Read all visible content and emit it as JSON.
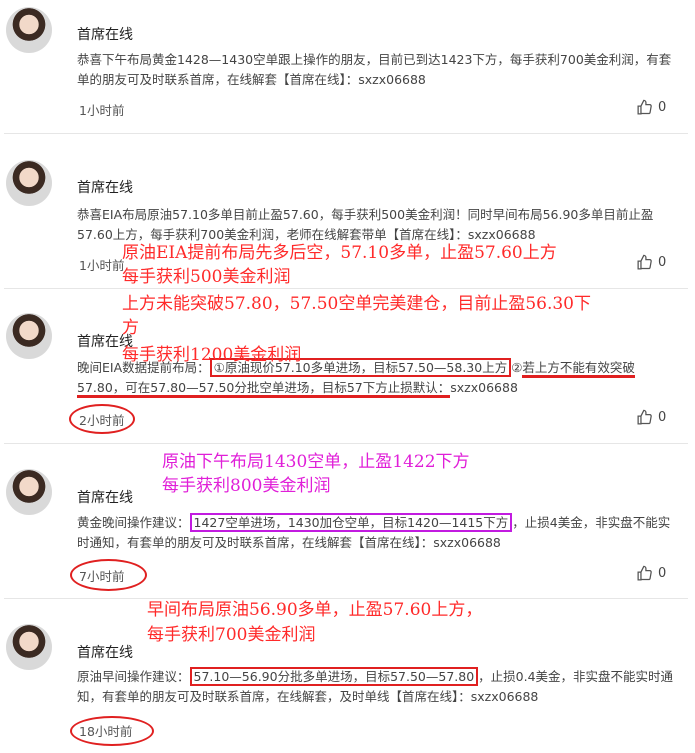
{
  "posts": [
    {
      "name": "首席在线",
      "content": "恭喜下午布局黄金1428—1430空单跟上操作的朋友，目前已到达1423下方，每手获利700美金利润，有套单的朋友可及时联系首席，在线解套【首席在线】：sxzx06688",
      "time": "1小时前",
      "likes": "0"
    },
    {
      "name": "首席在线",
      "content": "恭喜EIA布局原油57.10多单目前止盈57.60，每手获利500美金利润！同时早间布局56.90多单目前止盈57.60上方，每手获利700美金利润，老师在线解套带单【首席在线】：sxzx06688",
      "time": "1小时前",
      "likes": "0"
    },
    {
      "name": "首席在线",
      "content_parts": {
        "a": "晚间EIA数据提前布局：",
        "b": "①原油现价57.10多单进场，目标57.50—58.30上方",
        "c": "②",
        "d": "若上方不能有效突破",
        "e": "57.80，可在57.80—57.50分批空单进场，目标57下方止损默认：",
        "f": "sxzx06688"
      },
      "time": "2小时前",
      "likes": "0"
    },
    {
      "name": "首席在线",
      "content_parts": {
        "a": "黄金晚间操作建议：",
        "b": "1427空单进场，1430加仓空单，目标1420—1415下方",
        "c": "，止损4美金，非实盘不能实时通知，有套单的朋友可及时联系首席，在线解套【首席在线】：sxzx06688"
      },
      "time": "7小时前",
      "likes": "0"
    },
    {
      "name": "首席在线",
      "content_parts": {
        "a": "原油早间操作建议：",
        "b": "57.10—56.90分批多单进场，目标57.50—57.80",
        "c": "，止损0.4美金，非实盘不能实时通知，有套单的朋友可及时联系首席，在线解套，及时单线【首席在线】：sxzx06688"
      },
      "time": "18小时前",
      "likes": "0"
    }
  ],
  "annotations": {
    "a1_line1": "原油EIA提前布局先多后空，57.10多单，止盈57.60上方",
    "a1_line2": "每手获利500美金利润",
    "a2_line1": "上方未能突破57.80，57.50空单完美建仓，目前止盈56.30下",
    "a2_line2": "方",
    "a2_line3": "每手获利1200美金利润",
    "a3_line1": "原油下午布局1430空单，止盈1422下方",
    "a3_line2": "每手获利800美金利润",
    "a4_line1": "早间布局原油56.90多单，止盈57.60上方，",
    "a4_line2": "每手获利700美金利润"
  },
  "colors": {
    "annotation_red": "#ff2a2a",
    "annotation_pink": "#e01fd8",
    "highlight_red": "#e02020"
  }
}
